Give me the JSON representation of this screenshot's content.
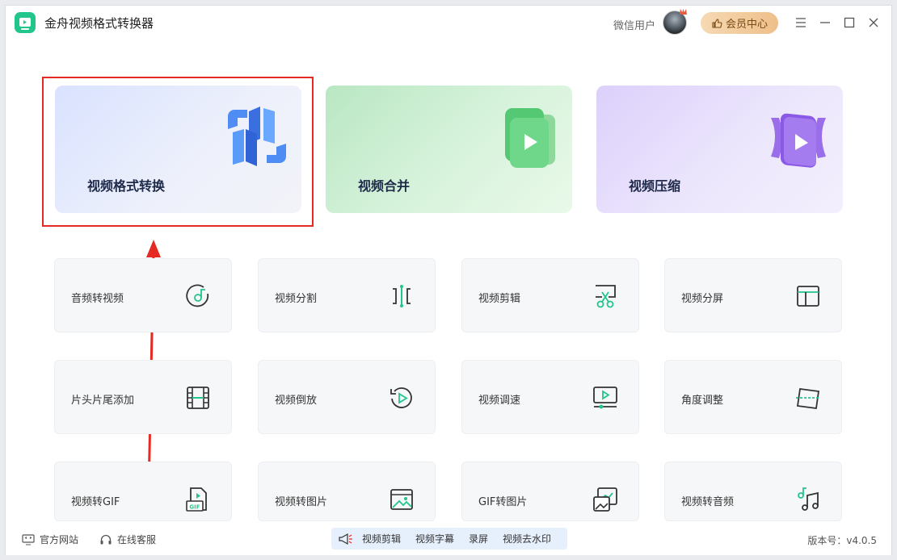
{
  "app": {
    "title": "金舟视频格式转换器",
    "icon": "app-logo-icon"
  },
  "user": {
    "name": "微信用户",
    "vip_label": "会员中心"
  },
  "window_controls": [
    "menu-icon",
    "minimize-icon",
    "maximize-icon",
    "close-icon"
  ],
  "feature_cards": [
    {
      "label": "视频格式转换",
      "icon": "convert-icon"
    },
    {
      "label": "视频合并",
      "icon": "merge-icon"
    },
    {
      "label": "视频压缩",
      "icon": "compress-icon"
    }
  ],
  "tools": [
    {
      "label": "音频转视频",
      "icon": "audio-to-video-icon"
    },
    {
      "label": "视频分割",
      "icon": "split-icon"
    },
    {
      "label": "视频剪辑",
      "icon": "scissors-icon"
    },
    {
      "label": "视频分屏",
      "icon": "split-screen-icon"
    },
    {
      "label": "片头片尾添加",
      "icon": "film-strip-icon"
    },
    {
      "label": "视频倒放",
      "icon": "reverse-play-icon"
    },
    {
      "label": "视频调速",
      "icon": "speed-icon"
    },
    {
      "label": "角度调整",
      "icon": "rotate-icon"
    },
    {
      "label": "视频转GIF",
      "icon": "gif-file-icon"
    },
    {
      "label": "视频转图片",
      "icon": "image-icon"
    },
    {
      "label": "GIF转图片",
      "icon": "gif-to-image-icon"
    },
    {
      "label": "视频转音频",
      "icon": "music-note-icon"
    }
  ],
  "bottom": {
    "website": "官方网站",
    "support": "在线客服",
    "promo_items": [
      "视频剪辑",
      "视频字幕",
      "录屏",
      "视频去水印"
    ],
    "version": "版本号：v4.0.5"
  },
  "colors": {
    "accent": "#22c58a",
    "highlight": "#e52a24",
    "vip": "#eebf8a"
  }
}
